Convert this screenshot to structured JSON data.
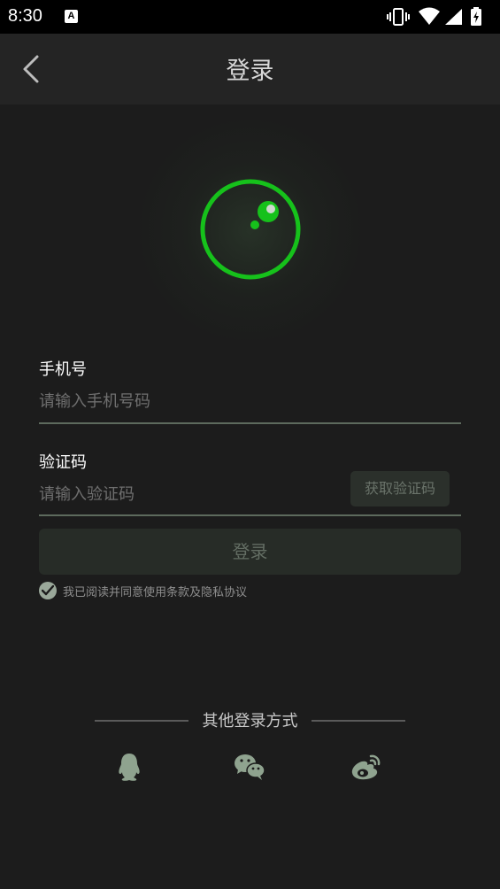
{
  "status_bar": {
    "time": "8:30",
    "notification_glyph": "A"
  },
  "header": {
    "title": "登录"
  },
  "phone": {
    "label": "手机号",
    "placeholder": "请输入手机号码",
    "value": ""
  },
  "code": {
    "label": "验证码",
    "placeholder": "请输入验证码",
    "value": "",
    "get_code_label": "获取验证码"
  },
  "login_button_label": "登录",
  "agreement": {
    "text": "我已阅读并同意使用条款及隐私协议",
    "checked": true
  },
  "other_login": {
    "label": "其他登录方式",
    "methods": [
      "qq-icon",
      "wechat-icon",
      "weibo-icon"
    ]
  },
  "colors": {
    "accent": "#16c11b",
    "background": "#1c1c1c",
    "app_bar": "#242424"
  }
}
